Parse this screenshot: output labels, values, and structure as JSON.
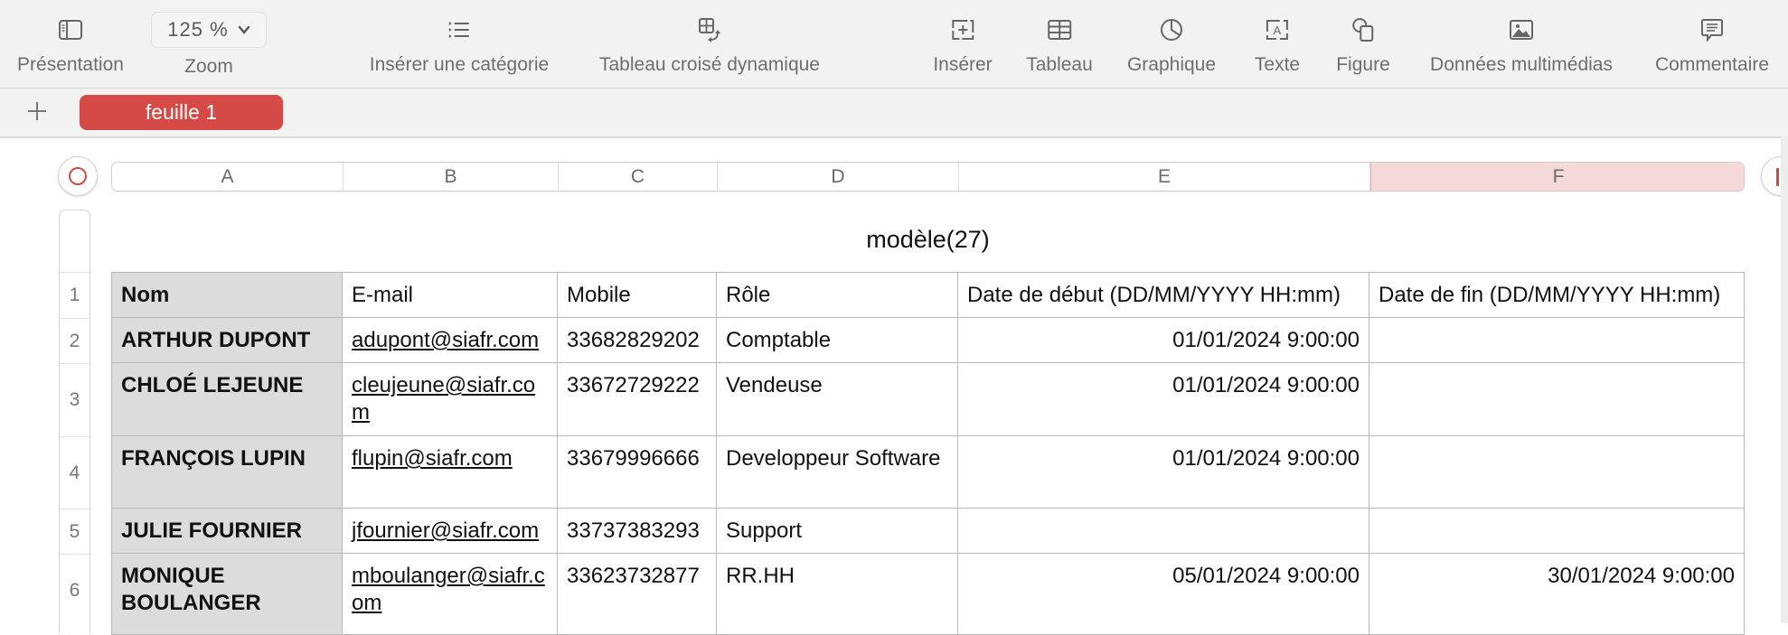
{
  "toolbar": {
    "items": [
      {
        "id": "presentation",
        "label": "Présentation",
        "icon": "sidebar-icon"
      },
      {
        "id": "insert-category",
        "label": "Insérer une catégorie",
        "icon": "list-icon"
      },
      {
        "id": "pivot-table",
        "label": "Tableau croisé dynamique",
        "icon": "pivot-table-icon"
      },
      {
        "id": "insert",
        "label": "Insérer",
        "icon": "insert-box-icon"
      },
      {
        "id": "table",
        "label": "Tableau",
        "icon": "table-icon"
      },
      {
        "id": "chart",
        "label": "Graphique",
        "icon": "pie-chart-icon"
      },
      {
        "id": "text",
        "label": "Texte",
        "icon": "text-box-icon"
      },
      {
        "id": "shape",
        "label": "Figure",
        "icon": "shape-icon"
      },
      {
        "id": "media",
        "label": "Données multimédias",
        "icon": "image-icon"
      },
      {
        "id": "comment",
        "label": "Commentaire",
        "icon": "comment-icon"
      }
    ],
    "zoom": {
      "value": "125 %",
      "label": "Zoom"
    }
  },
  "sheets": {
    "add_label": "+",
    "tabs": [
      {
        "label": "feuille 1",
        "active": true
      }
    ],
    "accent_color": "#d54a46"
  },
  "columns": [
    "A",
    "B",
    "C",
    "D",
    "E",
    "F"
  ],
  "selected_column": "F",
  "table": {
    "title": "modèle(27)",
    "row_numbers": [
      "1",
      "2",
      "3",
      "4",
      "5",
      "6"
    ],
    "header": [
      "Nom",
      "E-mail",
      "Mobile",
      "Rôle",
      "Date de début (DD/MM/YYYY HH:mm)",
      "Date de fin (DD/MM/YYYY HH:mm)"
    ],
    "rows": [
      [
        "ARTHUR DUPONT",
        "adupont@siafr.com",
        "33682829202",
        "Comptable",
        "01/01/2024 9:00:00",
        ""
      ],
      [
        "CHLOÉ LEJEUNE",
        "cleujeune@siafr.com",
        "33672729222",
        "Vendeuse",
        "01/01/2024 9:00:00",
        ""
      ],
      [
        "FRANÇOIS LUPIN",
        "flupin@siafr.com",
        "33679996666",
        "Developpeur Software",
        "01/01/2024 9:00:00",
        ""
      ],
      [
        "JULIE FOURNIER",
        "jfournier@siafr.com",
        "33737383293",
        "Support",
        "",
        ""
      ],
      [
        "MONIQUE BOULANGER",
        "mboulanger@siafr.com",
        "33623732877",
        "RR.HH",
        "05/01/2024 9:00:00",
        "30/01/2024 9:00:00"
      ]
    ]
  }
}
